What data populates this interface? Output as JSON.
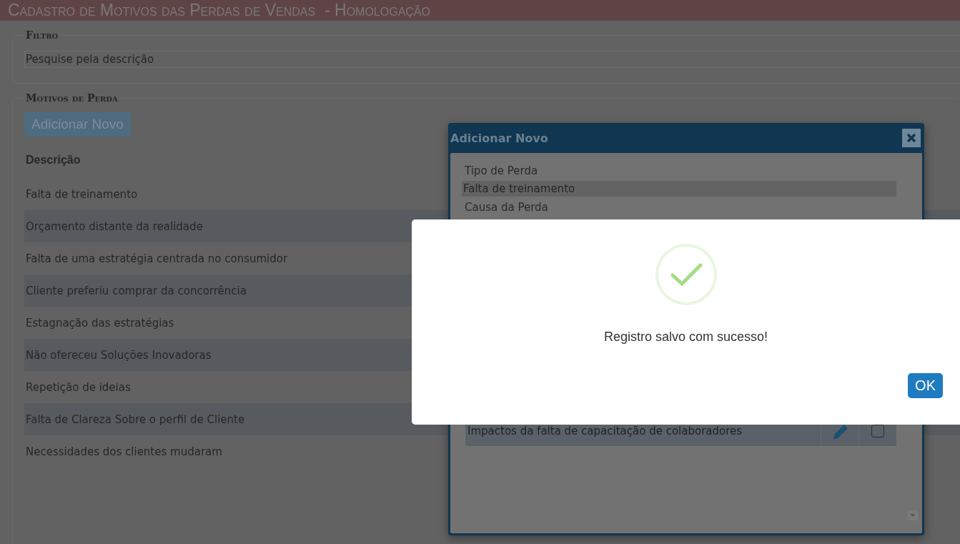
{
  "header": {
    "title": "Cadastro de Motivos das Perdas de Vendas  - Homologação"
  },
  "filter": {
    "legend": "Filtro",
    "search": {
      "placeholder": "Pesquise pela descrição"
    }
  },
  "reasons": {
    "legend": "Motivos de Perda",
    "add_button": "Adicionar Novo",
    "column": "Descrição",
    "rows": [
      {
        "text": "Falta de treinamento"
      },
      {
        "text": "Orçamento distante da realidade"
      },
      {
        "text": "Falta de uma estratégia centrada no consumidor"
      },
      {
        "text": "Cliente preferiu comprar da concorrência"
      },
      {
        "text": "Estagnação das estratégias"
      },
      {
        "text": "Não ofereceu Soluções Inovadoras"
      },
      {
        "text": "Repetição de ideias"
      },
      {
        "text": "Falta de Clareza Sobre o perfil de Cliente"
      },
      {
        "text": "Necessidades dos clientes mudaram"
      }
    ]
  },
  "dialog": {
    "title": "Adicionar Novo",
    "type_label": "Tipo de Perda",
    "type_value": "Falta de treinamento",
    "cause_label": "Causa da Perda",
    "causes": [
      {
        "text": "Impactos da falta de capacitação de colaboradores",
        "checked": false
      }
    ]
  },
  "alert": {
    "message": "Registro salvo com sucesso!",
    "ok_button": "OK"
  }
}
